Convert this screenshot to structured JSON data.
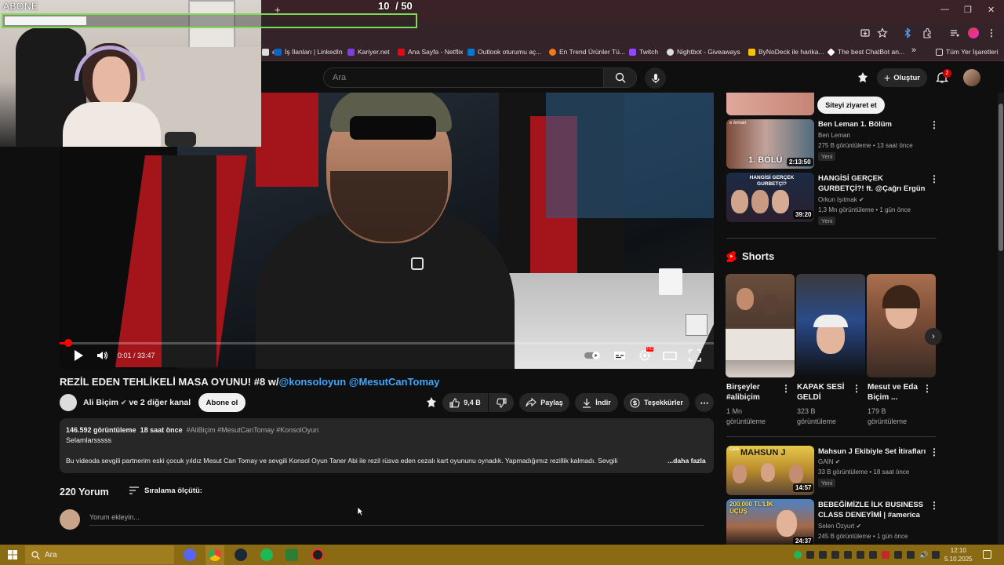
{
  "browser": {
    "bookmarks": [
      {
        "label": "İş İlanları | LinkedIn",
        "color": "#0a66c2"
      },
      {
        "label": "Kariyer.net",
        "color": "#7b3fe4"
      },
      {
        "label": "Ana Sayfa - Netflix",
        "color": "#e50914"
      },
      {
        "label": "Outlook oturumu aç...",
        "color": "#0078d4"
      },
      {
        "label": "En Trend Ürünler Tü...",
        "color": "#f27a1a"
      },
      {
        "label": "Twitch",
        "color": "#9146ff"
      },
      {
        "label": "Nightbot - Giveaways",
        "color": "#dddddd"
      },
      {
        "label": "ByNoDeck ile harika...",
        "color": "#f5c400"
      },
      {
        "label": "The best ChatBot an...",
        "color": "#ffffff"
      }
    ],
    "bookmarks_more": "»",
    "all_bookmarks": "Tüm Yer İşaretleri",
    "new_tab": "+"
  },
  "stream_overlay": {
    "goal_label": "ABONE",
    "goal_current": "10",
    "goal_target": "/ 50",
    "goal_fraction": 0.2
  },
  "header": {
    "search_placeholder": "Ara",
    "create_label": "Oluştur",
    "notifications_count": "2"
  },
  "player": {
    "time": "0:01 / 33:47",
    "progress_fraction": 0.0005
  },
  "video": {
    "title": "REZİL EDEN TEHLİKELİ MASA OYUNU! #8 w/",
    "title_mentions": "@konsoloyun @MesutCanTomay",
    "channel": "Ali Biçim",
    "channel_suffix": "ve 2 diğer kanal",
    "subscribe_label": "Abone ol",
    "likes": "9,4 B",
    "share_label": "Paylaş",
    "download_label": "İndir",
    "thanks_label": "Teşekkürler",
    "more_label": "⋯"
  },
  "description": {
    "views": "146.592 görüntüleme",
    "age": "18 saat önce",
    "tags": "#AliBiçim #MesutCanTomay #KonsolOyun",
    "line1": "Selamlarsssss",
    "line2": "Bu videoda sevgili partnerim eski çocuk yıldız Mesut Can Tomay ve sevgili Konsol Oyun Taner Abi ile rezil rüsva eden cezalı kart oyununu oynadık. Yapmadığımız rezillik kalmadı. Sevgili",
    "more": "...daha fazla"
  },
  "comments": {
    "count": "220 Yorum",
    "sort_label": "Sıralama ölçütü:",
    "input_placeholder": "Yorum ekleyin..."
  },
  "sidebar": {
    "visit_site": "Siteyi ziyaret et",
    "recs_top": [
      {
        "title": "Ben Leman 1. Bölüm",
        "channel": "Ben Leman",
        "meta": "275 B görüntüleme • 13 saat önce",
        "badge": "Yeni",
        "duration": "2:13:50",
        "thumb_text": "1. BÖLÜ"
      },
      {
        "title": "HANGİSİ GERÇEK GURBETÇİ?! ft. @Çağrı Ergün",
        "channel": "Orkun Işıtmak",
        "meta": "1,3 Mn görüntüleme • 1 gün önce",
        "badge": "Yeni",
        "duration": "39:20",
        "thumb_text": "HANGİSİ GERÇEK GURBETÇİ?"
      }
    ],
    "shorts_label": "Shorts",
    "shorts": [
      {
        "title": "Birşeyler #alibiçim",
        "views": "1 Mn görüntüleme"
      },
      {
        "title": "KAPAK SESİ GELDİ",
        "views": "323 B görüntüleme"
      },
      {
        "title": "Mesut ve Eda Biçim ...",
        "views": "179 B görüntüleme"
      }
    ],
    "recs_bottom": [
      {
        "title": "Mahsun J Ekibiyle Set İtirafları",
        "channel": "GAİN",
        "meta": "33 B görüntüleme • 18 saat önce",
        "badge": "Yeni",
        "duration": "14:57",
        "thumb_text": "MAHSUN J"
      },
      {
        "title": "BEBEĞİMİZLE İLK BUSINESS CLASS DENEYİMİ | #america",
        "channel": "Selen Özyurt",
        "meta": "245 B görüntüleme • 1 gün önce",
        "badge": "",
        "duration": "24:37",
        "thumb_text": "200.000 TL'LİK UÇUŞ"
      }
    ]
  },
  "taskbar": {
    "search_placeholder": "Ara",
    "time": "12:10",
    "date": "5.10.2025"
  }
}
